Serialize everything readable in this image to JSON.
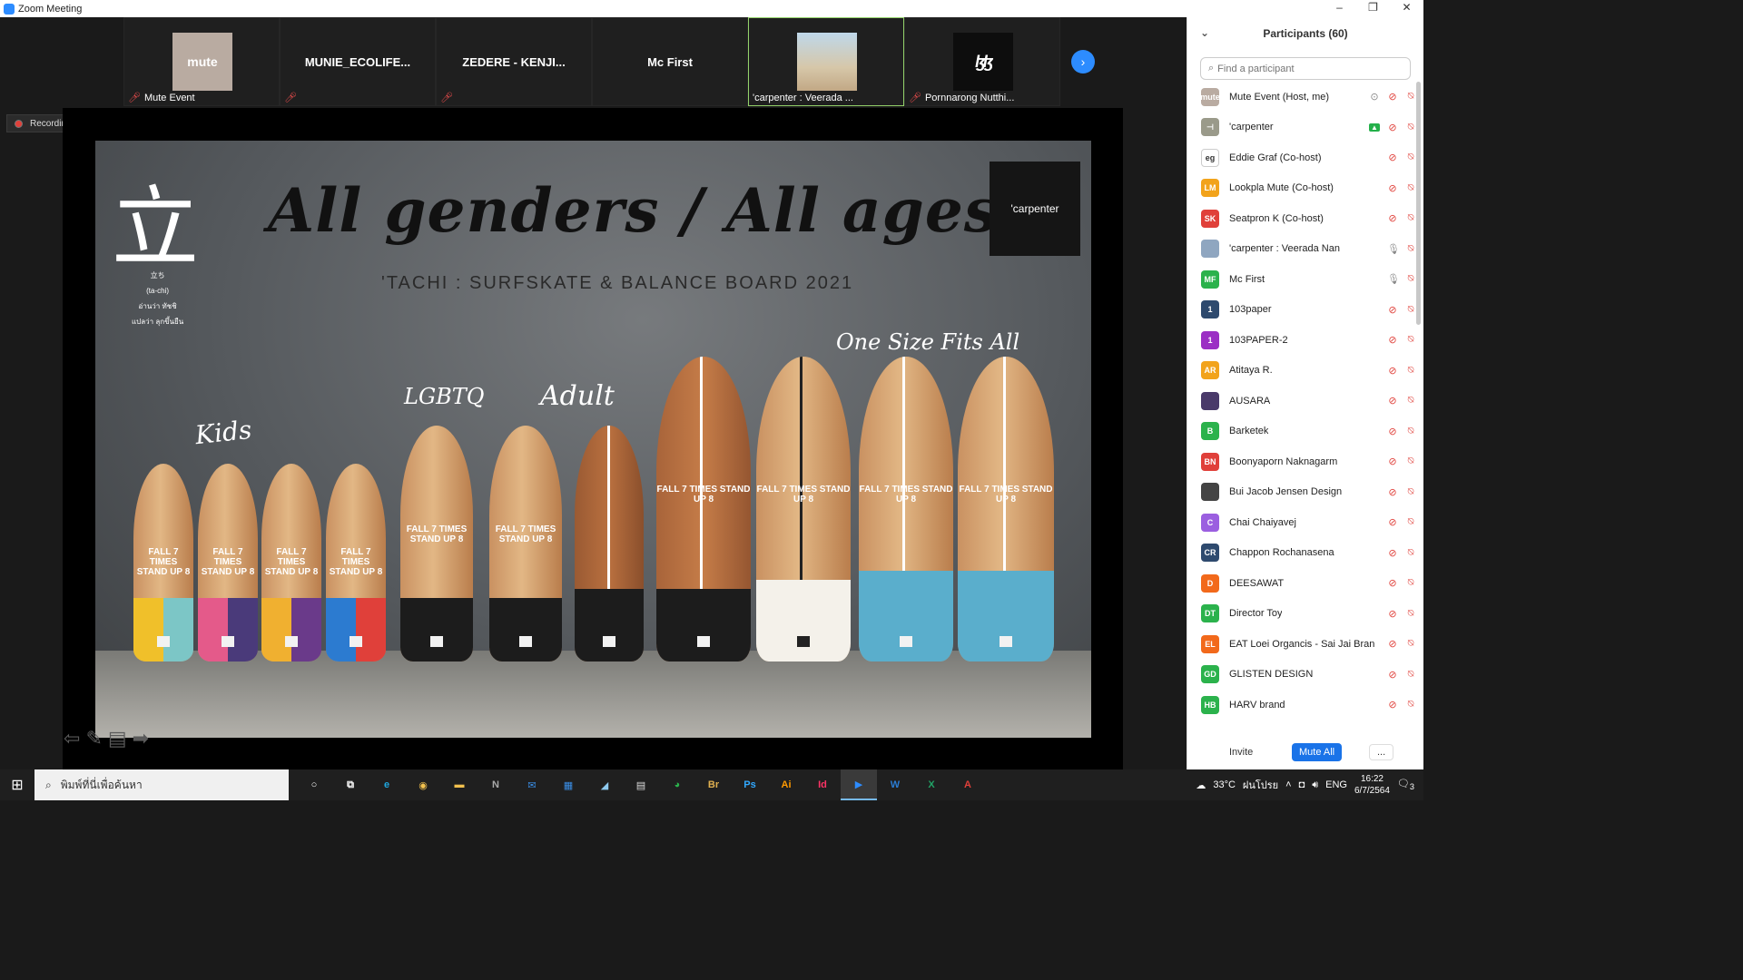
{
  "window": {
    "title": "Zoom Meeting",
    "minimize": "–",
    "restore": "❐",
    "close": "✕"
  },
  "strip": {
    "tiles": [
      {
        "name": "Mute Event",
        "thumb": "mute"
      },
      {
        "name": "MUNIE_ECOLIFE..."
      },
      {
        "name": "ZEDERE - KENJI..."
      },
      {
        "name": "Mc First"
      },
      {
        "name": "'carpenter : Veerada ..."
      },
      {
        "name": "Pornnarong Nutthi...",
        "thumb": "ɮɮ"
      }
    ],
    "next": "›"
  },
  "recording": {
    "label": "Recording..."
  },
  "slide": {
    "kanji": "立",
    "kanji_notes": [
      "立ち",
      "(ta-chi)",
      "อ่านว่า ทัชชิ",
      "แปลว่า ลุกขึ้นยืน"
    ],
    "headline": "All genders / All ages",
    "subhead": "'TACHI : SURFSKATE & BALANCE BOARD 2021",
    "brand": "'carpenter",
    "labels": {
      "kids": "Kids",
      "lgbtq": "LGBTQ",
      "adult": "Adult",
      "one_size": "One Size Fits All"
    },
    "board_text": "FALL 7 TIMES STAND UP 8"
  },
  "controls": {
    "prev": "⇦",
    "pen": "✎",
    "menu": "▤",
    "next": "➡"
  },
  "participants": {
    "title": "Participants (60)",
    "search_placeholder": "Find a participant",
    "list": [
      {
        "name": "Mute Event (Host, me)",
        "initials": "mute",
        "color": "#b9aba1",
        "mic": "off",
        "extra": "rec"
      },
      {
        "name": "'carpenter",
        "initials": "⊣",
        "color": "#9a9a8a",
        "mic": "off",
        "extra": "share"
      },
      {
        "name": "Eddie Graf (Co-host)",
        "initials": "eg",
        "color": "#ffffff",
        "mic": "off"
      },
      {
        "name": "Lookpla Mute (Co-host)",
        "initials": "LM",
        "color": "#f2a31b",
        "mic": "off"
      },
      {
        "name": "Seatpron K (Co-host)",
        "initials": "SK",
        "color": "#e0403a",
        "mic": "off"
      },
      {
        "name": "'carpenter : Veerada Nan",
        "initials": "",
        "color": "#8fa6c0",
        "mic": "on"
      },
      {
        "name": "Mc First",
        "initials": "MF",
        "color": "#2bb24c",
        "mic": "on"
      },
      {
        "name": "103paper",
        "initials": "1",
        "color": "#2e4a6e",
        "mic": "off"
      },
      {
        "name": "103PAPER-2",
        "initials": "1",
        "color": "#9b2fc4",
        "mic": "off"
      },
      {
        "name": "Atitaya R.",
        "initials": "AR",
        "color": "#f2a31b",
        "mic": "off"
      },
      {
        "name": "AUSARA",
        "initials": "",
        "color": "#4a3a6a",
        "mic": "off"
      },
      {
        "name": "Barketek",
        "initials": "B",
        "color": "#2bb24c",
        "mic": "off"
      },
      {
        "name": "Boonyaporn Naknagarm",
        "initials": "BN",
        "color": "#e0403a",
        "mic": "off"
      },
      {
        "name": "Bui Jacob Jensen Design",
        "initials": "",
        "color": "#444444",
        "mic": "off"
      },
      {
        "name": "Chai Chaiyavej",
        "initials": "C",
        "color": "#9b5fe0",
        "mic": "off"
      },
      {
        "name": "Chappon Rochanasena",
        "initials": "CR",
        "color": "#2e4a6e",
        "mic": "off"
      },
      {
        "name": "DEESAWAT",
        "initials": "D",
        "color": "#f2691b",
        "mic": "off"
      },
      {
        "name": "Director Toy",
        "initials": "DT",
        "color": "#2bb24c",
        "mic": "off"
      },
      {
        "name": "EAT Loei Organcis - Sai Jai Brand",
        "initials": "EL",
        "color": "#f2691b",
        "mic": "off"
      },
      {
        "name": "GLISTEN DESIGN",
        "initials": "GD",
        "color": "#2bb24c",
        "mic": "off"
      },
      {
        "name": "HARV brand",
        "initials": "HB",
        "color": "#2bb24c",
        "mic": "off"
      }
    ],
    "invite": "Invite",
    "mute_all": "Mute All",
    "more": "..."
  },
  "taskbar": {
    "start": "⊞",
    "search_text": "พิมพ์ที่นี่เพื่อค้นหา",
    "apps": [
      {
        "label": "○",
        "color": "#fff"
      },
      {
        "label": "⧉",
        "color": "#fff"
      },
      {
        "label": "e",
        "color": "#1fa8e0"
      },
      {
        "label": "◉",
        "color": "#f2c14e"
      },
      {
        "label": "▬",
        "color": "#f2c14e"
      },
      {
        "label": "N",
        "color": "#aaa"
      },
      {
        "label": "✉",
        "color": "#3a8ee6"
      },
      {
        "label": "▦",
        "color": "#3a8ee6"
      },
      {
        "label": "◢",
        "color": "#8ec9ef"
      },
      {
        "label": "▤",
        "color": "#ddd"
      },
      {
        "label": "◕",
        "color": "#2bb24c"
      },
      {
        "label": "Br",
        "color": "#e0b050"
      },
      {
        "label": "Ps",
        "color": "#31a8ff"
      },
      {
        "label": "Ai",
        "color": "#ff9a00"
      },
      {
        "label": "Id",
        "color": "#ff3366"
      },
      {
        "label": "▶",
        "color": "#2D8CFF",
        "active": true
      },
      {
        "label": "W",
        "color": "#2b7cd3"
      },
      {
        "label": "X",
        "color": "#21a366"
      },
      {
        "label": "A",
        "color": "#e0403a"
      }
    ],
    "weather": "33°C",
    "weather_text": "ฝนโปรย",
    "lang": "ENG",
    "time": "16:22",
    "date": "6/7/2564",
    "notif": "3"
  }
}
